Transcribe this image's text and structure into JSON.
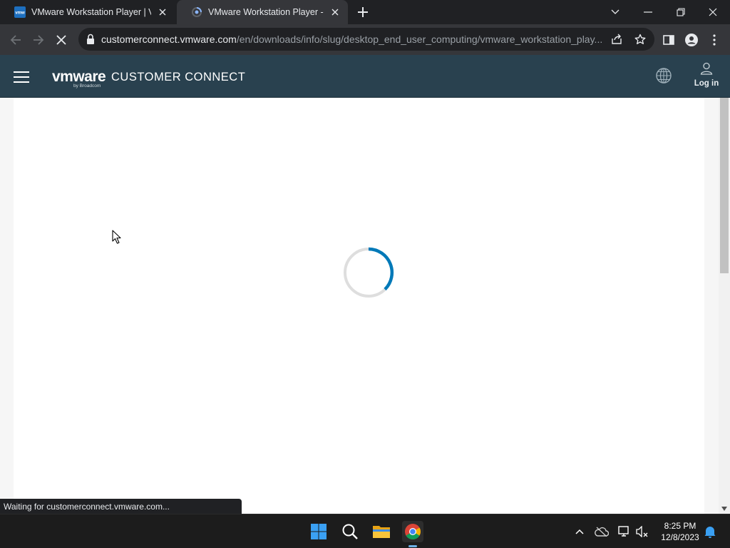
{
  "browser": {
    "tabs": [
      {
        "title": "VMware Workstation Player | VM",
        "favicon": "vmware-favicon",
        "state": "inactive"
      },
      {
        "title": "VMware Workstation Player - VM",
        "favicon": "loading-favicon",
        "state": "active"
      }
    ],
    "url": {
      "host": "customerconnect.vmware.com",
      "path": "/en/downloads/info/slug/desktop_end_user_computing/vmware_workstation_play..."
    },
    "status_text": "Waiting for customerconnect.vmware.com..."
  },
  "site_header": {
    "logo_mark": "vmware",
    "logo_sub": "by Broadcom",
    "title": "CUSTOMER CONNECT",
    "login_label": "Log in"
  },
  "page": {
    "state": "loading",
    "spinner_color": "#0079b8"
  },
  "taskbar": {
    "apps": [
      "windows-start",
      "search",
      "file-explorer",
      "chrome"
    ],
    "time": "8:25 PM",
    "date": "12/8/2023"
  },
  "colors": {
    "header_bg": "#29414f",
    "chrome_dark": "#202124",
    "chrome_toolbar": "#35363a",
    "taskbar_bg": "#1c1c1c"
  }
}
